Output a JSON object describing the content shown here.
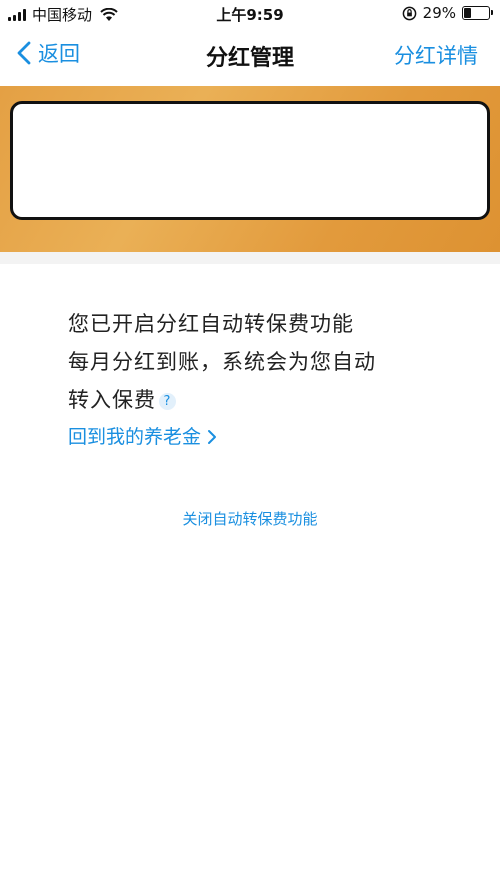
{
  "status_bar": {
    "carrier": "中国移动",
    "time": "上午9:59",
    "battery_percent": "29%",
    "battery_level": 0.29
  },
  "nav": {
    "back_label": "返回",
    "title": "分红管理",
    "right_label": "分红详情"
  },
  "content": {
    "line1": "您已开启分红自动转保费功能",
    "line2": "每月分红到账，系统会为您自动",
    "line3": "转入保费",
    "help_symbol": "?",
    "link_label": "回到我的养老金"
  },
  "footer": {
    "close_label": "关闭自动转保费功能"
  },
  "colors": {
    "accent": "#1a8fe0",
    "banner": "#e4a044"
  }
}
